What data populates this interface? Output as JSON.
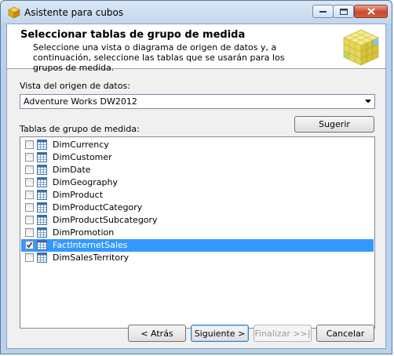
{
  "window": {
    "title": "Asistente para cubos"
  },
  "header": {
    "title": "Seleccionar tablas de grupo de medida",
    "description": "Seleccione una vista o diagrama de origen de datos y, a continuación, seleccione las tablas que se usarán para los grupos de medida."
  },
  "datasource": {
    "label": "Vista del origen de datos:",
    "selected": "Adventure Works DW2012"
  },
  "measure_tables": {
    "label": "Tablas de grupo de medida:",
    "suggest_label": "Sugerir",
    "items": [
      {
        "name": "DimCurrency",
        "checked": false,
        "selected": false
      },
      {
        "name": "DimCustomer",
        "checked": false,
        "selected": false
      },
      {
        "name": "DimDate",
        "checked": false,
        "selected": false
      },
      {
        "name": "DimGeography",
        "checked": false,
        "selected": false
      },
      {
        "name": "DimProduct",
        "checked": false,
        "selected": false
      },
      {
        "name": "DimProductCategory",
        "checked": false,
        "selected": false
      },
      {
        "name": "DimProductSubcategory",
        "checked": false,
        "selected": false
      },
      {
        "name": "DimPromotion",
        "checked": false,
        "selected": false
      },
      {
        "name": "FactInternetSales",
        "checked": true,
        "selected": true
      },
      {
        "name": "DimSalesTerritory",
        "checked": false,
        "selected": false
      }
    ]
  },
  "buttons": {
    "back": "< Atrás",
    "next": "Siguiente >",
    "finish": "Finalizar >>|",
    "cancel": "Cancelar"
  },
  "colors": {
    "selection": "#3399ff",
    "window_frame": "#b9d1ea"
  }
}
